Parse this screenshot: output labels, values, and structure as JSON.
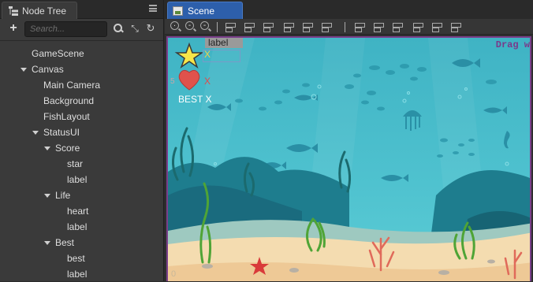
{
  "node_tree": {
    "tab_title": "Node Tree",
    "search_placeholder": "Search...",
    "nodes": [
      {
        "label": "GameScene"
      },
      {
        "label": "Canvas"
      },
      {
        "label": "Main Camera"
      },
      {
        "label": "Background"
      },
      {
        "label": "FishLayout"
      },
      {
        "label": "StatusUI"
      },
      {
        "label": "Score"
      },
      {
        "label": "star"
      },
      {
        "label": "label"
      },
      {
        "label": "Life"
      },
      {
        "label": "heart"
      },
      {
        "label": "label"
      },
      {
        "label": "Best"
      },
      {
        "label": "best"
      },
      {
        "label": "label"
      }
    ]
  },
  "scene": {
    "tab_title": "Scene",
    "drag_hint": "Drag w",
    "hud": {
      "label_chip": "label",
      "score_x": "X",
      "life_x": "X",
      "life_count_ghost": "5",
      "best_text": "BEST X"
    },
    "coordinate_readout": "0"
  },
  "colors": {
    "scene_tab": "#2d5fab",
    "selection_border": "#7a3f8a",
    "water_top": "#3fb3c4",
    "sand": "#f4dcb0"
  }
}
